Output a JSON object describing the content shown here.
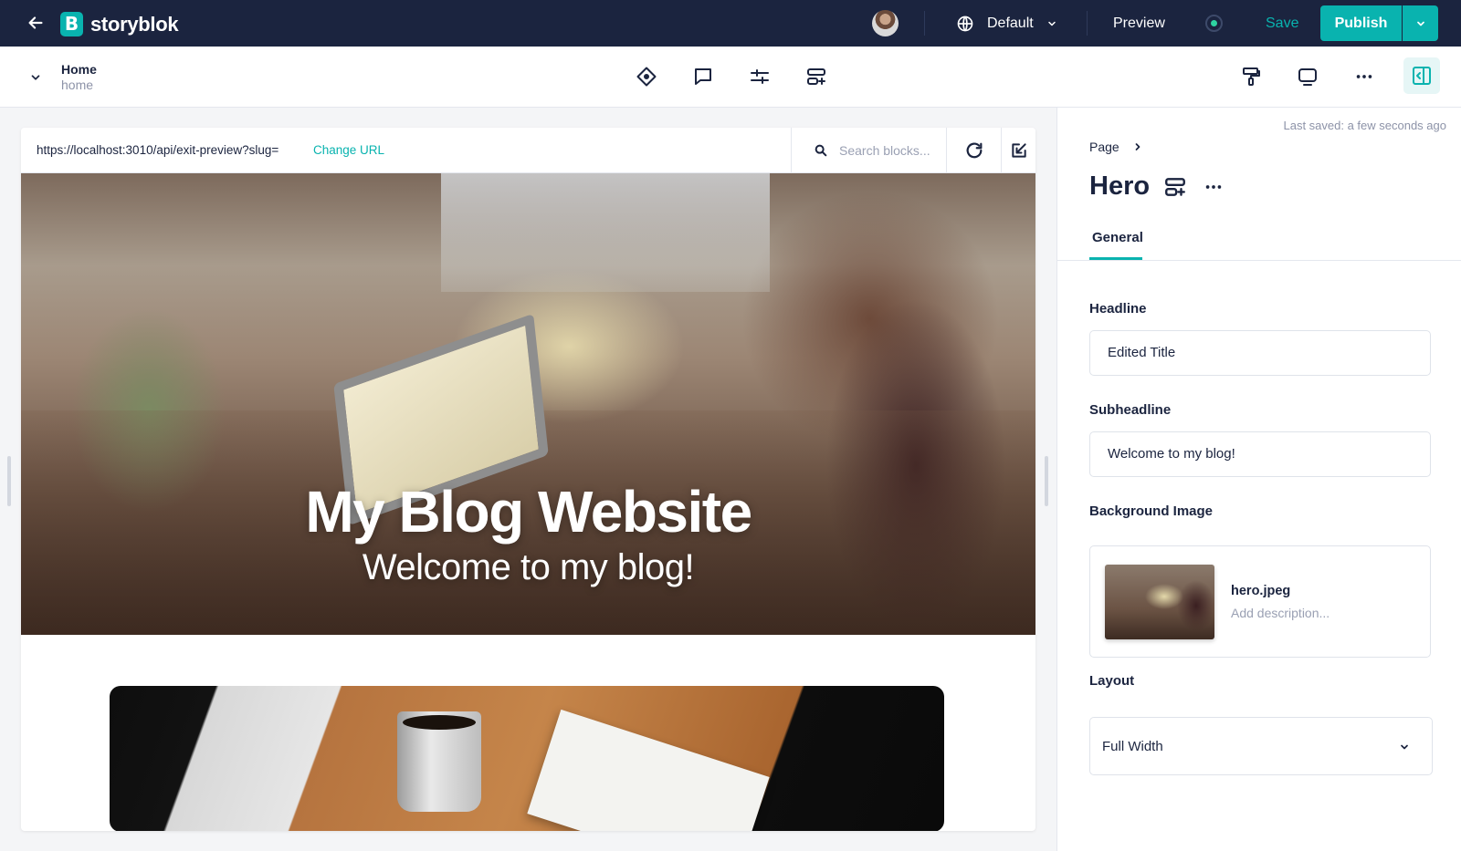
{
  "header": {
    "logo_text": "storyblok",
    "logo_letter": "B",
    "language": "Default",
    "preview_label": "Preview",
    "save_label": "Save",
    "publish_label": "Publish"
  },
  "story": {
    "title": "Home",
    "slug": "home"
  },
  "preview": {
    "url": "https://localhost:3010/api/exit-preview?slug=",
    "change_url_label": "Change URL",
    "search_placeholder": "Search blocks...",
    "hero_title": "My Blog Website",
    "hero_subtitle": "Welcome to my blog!"
  },
  "sidebar": {
    "last_saved": "Last saved: a few seconds ago",
    "breadcrumb": "Page",
    "block_title": "Hero",
    "tab_general": "General",
    "fields": {
      "headline_label": "Headline",
      "headline_value": "Edited Title",
      "subheadline_label": "Subheadline",
      "subheadline_value": "Welcome to my blog!",
      "background_image_label": "Background Image",
      "asset_name": "hero.jpeg",
      "asset_description": "Add description...",
      "layout_label": "Layout",
      "layout_value": "Full Width"
    }
  },
  "colors": {
    "topbar_bg": "#1b243f",
    "accent": "#09b3af",
    "status_green": "#2ed3a2"
  },
  "icons": [
    "back-arrow-icon",
    "globe-icon",
    "chevron-down-icon",
    "status-dot-icon",
    "diamond-icon",
    "comment-icon",
    "sliders-icon",
    "add-block-icon",
    "paint-roller-icon",
    "device-icon",
    "more-icon",
    "sidebar-toggle-icon",
    "search-icon",
    "refresh-icon",
    "open-external-icon",
    "chevron-right-icon"
  ]
}
